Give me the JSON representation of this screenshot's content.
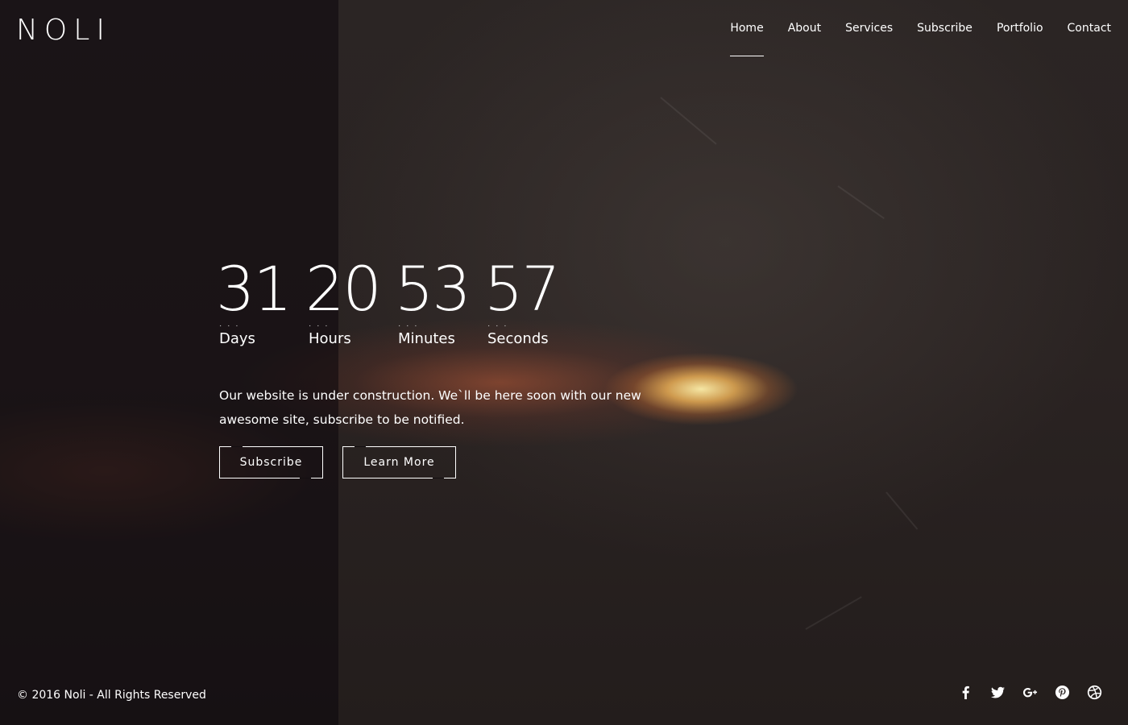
{
  "brand": {
    "logo": "NOLI"
  },
  "nav": {
    "items": [
      {
        "label": "Home",
        "active": true
      },
      {
        "label": "About"
      },
      {
        "label": "Services"
      },
      {
        "label": "Subscribe"
      },
      {
        "label": "Portfolio"
      },
      {
        "label": "Contact"
      }
    ]
  },
  "countdown": {
    "days": {
      "value": "31",
      "label": "Days"
    },
    "hours": {
      "value": "20",
      "label": "Hours"
    },
    "minutes": {
      "value": "53",
      "label": "Minutes"
    },
    "seconds": {
      "value": "57",
      "label": "Seconds"
    },
    "dots": "· · ·"
  },
  "hero": {
    "message": "Our website is under construction. We`ll be here soon with our new awesome site, subscribe to be notified.",
    "subscribe_label": "Subscribe",
    "learn_more_label": "Learn More"
  },
  "footer": {
    "copyright": "© 2016 Noli - All Rights Reserved",
    "social": [
      "facebook-icon",
      "twitter-icon",
      "google-plus-icon",
      "pinterest-icon",
      "dribbble-icon"
    ]
  },
  "colors": {
    "text": "#ffffff",
    "background": "#2a2322",
    "panel": "#0c080c"
  }
}
